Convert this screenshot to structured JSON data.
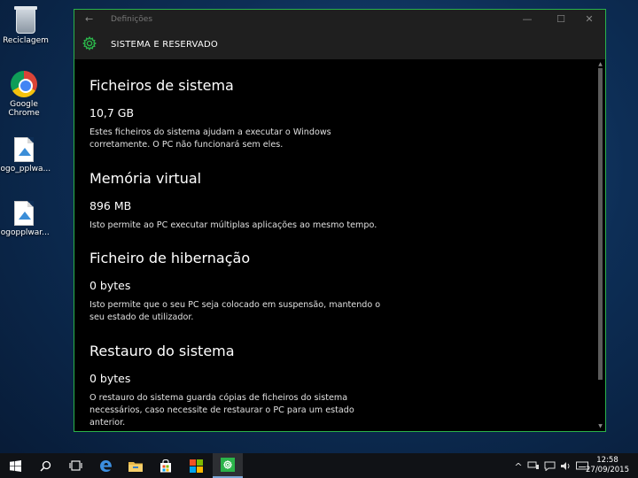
{
  "desktop": {
    "icons": [
      {
        "label": "Reciclagem",
        "icon": "recycle-bin-icon"
      },
      {
        "label": "Google Chrome",
        "icon": "chrome-icon"
      },
      {
        "label": "logo_pplwa...",
        "icon": "image-file-icon"
      },
      {
        "label": "logopplwar...",
        "icon": "image-file-icon"
      }
    ]
  },
  "window": {
    "title": "Definições",
    "back_glyph": "←",
    "minimize_glyph": "—",
    "maximize_glyph": "☐",
    "close_glyph": "✕",
    "accent": "#2bb34a",
    "header": "SISTEMA E RESERVADO"
  },
  "sections": [
    {
      "title": "Ficheiros de sistema",
      "size": "10,7 GB",
      "description": "Estes ficheiros do sistema ajudam a executar o Windows corretamente. O PC não funcionará sem eles."
    },
    {
      "title": "Memória virtual",
      "size": "896 MB",
      "description": "Isto permite ao PC executar múltiplas aplicações ao mesmo tempo."
    },
    {
      "title": "Ficheiro de hibernação",
      "size": "0 bytes",
      "description": "Isto permite que o seu PC seja colocado em suspensão, mantendo o seu estado de utilizador."
    },
    {
      "title": "Restauro do sistema",
      "size": "0 bytes",
      "description": "O restauro do sistema guarda cópias de ficheiros do sistema necessários, caso necessite de restaurar o PC para um estado anterior."
    }
  ],
  "taskbar": {
    "clock_time": "12:58",
    "clock_date": "27/09/2015",
    "tray_chevron": "^"
  }
}
